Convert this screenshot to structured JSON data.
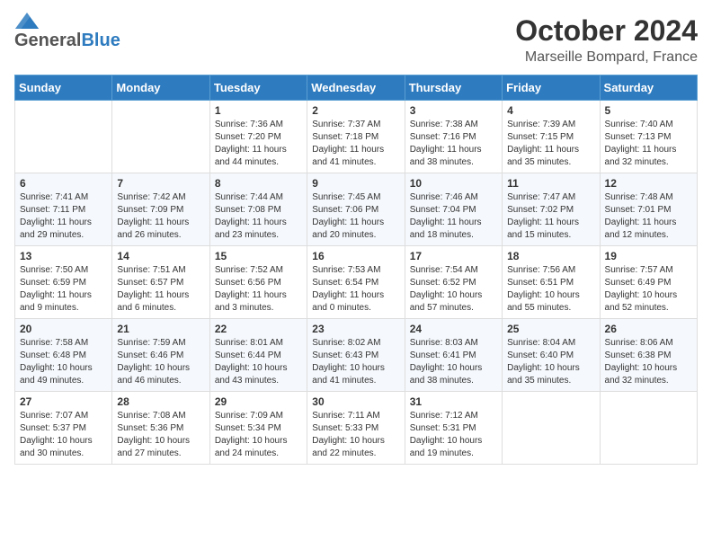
{
  "header": {
    "logo_general": "General",
    "logo_blue": "Blue",
    "month": "October 2024",
    "location": "Marseille Bompard, France"
  },
  "weekdays": [
    "Sunday",
    "Monday",
    "Tuesday",
    "Wednesday",
    "Thursday",
    "Friday",
    "Saturday"
  ],
  "weeks": [
    [
      {
        "day": "",
        "sunrise": "",
        "sunset": "",
        "daylight": ""
      },
      {
        "day": "",
        "sunrise": "",
        "sunset": "",
        "daylight": ""
      },
      {
        "day": "1",
        "sunrise": "Sunrise: 7:36 AM",
        "sunset": "Sunset: 7:20 PM",
        "daylight": "Daylight: 11 hours and 44 minutes."
      },
      {
        "day": "2",
        "sunrise": "Sunrise: 7:37 AM",
        "sunset": "Sunset: 7:18 PM",
        "daylight": "Daylight: 11 hours and 41 minutes."
      },
      {
        "day": "3",
        "sunrise": "Sunrise: 7:38 AM",
        "sunset": "Sunset: 7:16 PM",
        "daylight": "Daylight: 11 hours and 38 minutes."
      },
      {
        "day": "4",
        "sunrise": "Sunrise: 7:39 AM",
        "sunset": "Sunset: 7:15 PM",
        "daylight": "Daylight: 11 hours and 35 minutes."
      },
      {
        "day": "5",
        "sunrise": "Sunrise: 7:40 AM",
        "sunset": "Sunset: 7:13 PM",
        "daylight": "Daylight: 11 hours and 32 minutes."
      }
    ],
    [
      {
        "day": "6",
        "sunrise": "Sunrise: 7:41 AM",
        "sunset": "Sunset: 7:11 PM",
        "daylight": "Daylight: 11 hours and 29 minutes."
      },
      {
        "day": "7",
        "sunrise": "Sunrise: 7:42 AM",
        "sunset": "Sunset: 7:09 PM",
        "daylight": "Daylight: 11 hours and 26 minutes."
      },
      {
        "day": "8",
        "sunrise": "Sunrise: 7:44 AM",
        "sunset": "Sunset: 7:08 PM",
        "daylight": "Daylight: 11 hours and 23 minutes."
      },
      {
        "day": "9",
        "sunrise": "Sunrise: 7:45 AM",
        "sunset": "Sunset: 7:06 PM",
        "daylight": "Daylight: 11 hours and 20 minutes."
      },
      {
        "day": "10",
        "sunrise": "Sunrise: 7:46 AM",
        "sunset": "Sunset: 7:04 PM",
        "daylight": "Daylight: 11 hours and 18 minutes."
      },
      {
        "day": "11",
        "sunrise": "Sunrise: 7:47 AM",
        "sunset": "Sunset: 7:02 PM",
        "daylight": "Daylight: 11 hours and 15 minutes."
      },
      {
        "day": "12",
        "sunrise": "Sunrise: 7:48 AM",
        "sunset": "Sunset: 7:01 PM",
        "daylight": "Daylight: 11 hours and 12 minutes."
      }
    ],
    [
      {
        "day": "13",
        "sunrise": "Sunrise: 7:50 AM",
        "sunset": "Sunset: 6:59 PM",
        "daylight": "Daylight: 11 hours and 9 minutes."
      },
      {
        "day": "14",
        "sunrise": "Sunrise: 7:51 AM",
        "sunset": "Sunset: 6:57 PM",
        "daylight": "Daylight: 11 hours and 6 minutes."
      },
      {
        "day": "15",
        "sunrise": "Sunrise: 7:52 AM",
        "sunset": "Sunset: 6:56 PM",
        "daylight": "Daylight: 11 hours and 3 minutes."
      },
      {
        "day": "16",
        "sunrise": "Sunrise: 7:53 AM",
        "sunset": "Sunset: 6:54 PM",
        "daylight": "Daylight: 11 hours and 0 minutes."
      },
      {
        "day": "17",
        "sunrise": "Sunrise: 7:54 AM",
        "sunset": "Sunset: 6:52 PM",
        "daylight": "Daylight: 10 hours and 57 minutes."
      },
      {
        "day": "18",
        "sunrise": "Sunrise: 7:56 AM",
        "sunset": "Sunset: 6:51 PM",
        "daylight": "Daylight: 10 hours and 55 minutes."
      },
      {
        "day": "19",
        "sunrise": "Sunrise: 7:57 AM",
        "sunset": "Sunset: 6:49 PM",
        "daylight": "Daylight: 10 hours and 52 minutes."
      }
    ],
    [
      {
        "day": "20",
        "sunrise": "Sunrise: 7:58 AM",
        "sunset": "Sunset: 6:48 PM",
        "daylight": "Daylight: 10 hours and 49 minutes."
      },
      {
        "day": "21",
        "sunrise": "Sunrise: 7:59 AM",
        "sunset": "Sunset: 6:46 PM",
        "daylight": "Daylight: 10 hours and 46 minutes."
      },
      {
        "day": "22",
        "sunrise": "Sunrise: 8:01 AM",
        "sunset": "Sunset: 6:44 PM",
        "daylight": "Daylight: 10 hours and 43 minutes."
      },
      {
        "day": "23",
        "sunrise": "Sunrise: 8:02 AM",
        "sunset": "Sunset: 6:43 PM",
        "daylight": "Daylight: 10 hours and 41 minutes."
      },
      {
        "day": "24",
        "sunrise": "Sunrise: 8:03 AM",
        "sunset": "Sunset: 6:41 PM",
        "daylight": "Daylight: 10 hours and 38 minutes."
      },
      {
        "day": "25",
        "sunrise": "Sunrise: 8:04 AM",
        "sunset": "Sunset: 6:40 PM",
        "daylight": "Daylight: 10 hours and 35 minutes."
      },
      {
        "day": "26",
        "sunrise": "Sunrise: 8:06 AM",
        "sunset": "Sunset: 6:38 PM",
        "daylight": "Daylight: 10 hours and 32 minutes."
      }
    ],
    [
      {
        "day": "27",
        "sunrise": "Sunrise: 7:07 AM",
        "sunset": "Sunset: 5:37 PM",
        "daylight": "Daylight: 10 hours and 30 minutes."
      },
      {
        "day": "28",
        "sunrise": "Sunrise: 7:08 AM",
        "sunset": "Sunset: 5:36 PM",
        "daylight": "Daylight: 10 hours and 27 minutes."
      },
      {
        "day": "29",
        "sunrise": "Sunrise: 7:09 AM",
        "sunset": "Sunset: 5:34 PM",
        "daylight": "Daylight: 10 hours and 24 minutes."
      },
      {
        "day": "30",
        "sunrise": "Sunrise: 7:11 AM",
        "sunset": "Sunset: 5:33 PM",
        "daylight": "Daylight: 10 hours and 22 minutes."
      },
      {
        "day": "31",
        "sunrise": "Sunrise: 7:12 AM",
        "sunset": "Sunset: 5:31 PM",
        "daylight": "Daylight: 10 hours and 19 minutes."
      },
      {
        "day": "",
        "sunrise": "",
        "sunset": "",
        "daylight": ""
      },
      {
        "day": "",
        "sunrise": "",
        "sunset": "",
        "daylight": ""
      }
    ]
  ]
}
